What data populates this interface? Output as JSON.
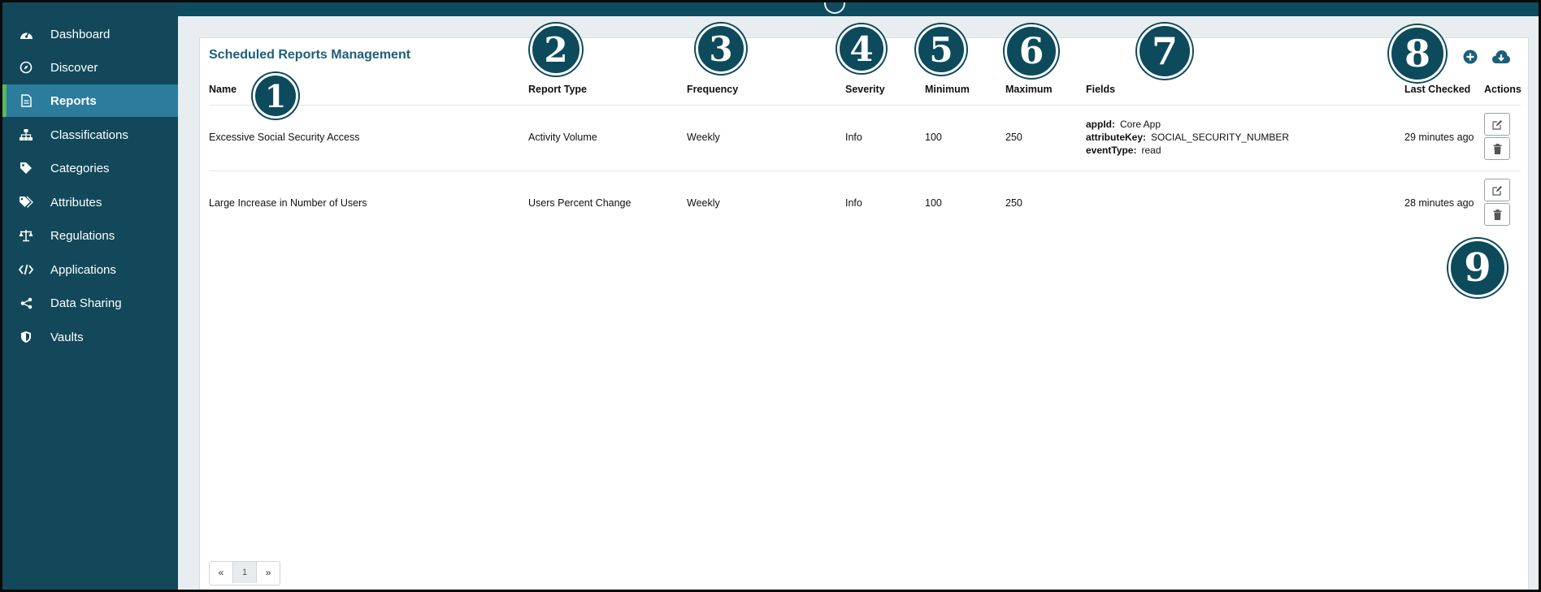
{
  "sidebar": {
    "items": [
      {
        "label": "Dashboard",
        "icon": "dashboard-icon"
      },
      {
        "label": "Discover",
        "icon": "compass-icon"
      },
      {
        "label": "Reports",
        "icon": "report-file-icon",
        "active": true
      },
      {
        "label": "Classifications",
        "icon": "sitemap-icon"
      },
      {
        "label": "Categories",
        "icon": "tag-icon"
      },
      {
        "label": "Attributes",
        "icon": "tags-icon"
      },
      {
        "label": "Regulations",
        "icon": "balance-scale-icon"
      },
      {
        "label": "Applications",
        "icon": "code-icon"
      },
      {
        "label": "Data Sharing",
        "icon": "share-icon"
      },
      {
        "label": "Vaults",
        "icon": "shield-icon"
      }
    ]
  },
  "panel": {
    "title": "Scheduled Reports Management",
    "columns": [
      "Name",
      "Report Type",
      "Frequency",
      "Severity",
      "Minimum",
      "Maximum",
      "Fields",
      "Last Checked",
      "Actions"
    ],
    "rows": [
      {
        "name": "Excessive Social Security Access",
        "report_type": "Activity Volume",
        "frequency": "Weekly",
        "severity": "Info",
        "minimum": "100",
        "maximum": "250",
        "fields": [
          {
            "key": "appId:",
            "value": "Core App"
          },
          {
            "key": "attributeKey:",
            "value": "SOCIAL_SECURITY_NUMBER"
          },
          {
            "key": "eventType:",
            "value": "read"
          }
        ],
        "last_checked": "29 minutes ago"
      },
      {
        "name": "Large Increase in Number of Users",
        "report_type": "Users Percent Change",
        "frequency": "Weekly",
        "severity": "Info",
        "minimum": "100",
        "maximum": "250",
        "fields": [],
        "last_checked": "28 minutes ago"
      }
    ],
    "toolbar": {
      "add_icon": "plus-circle-icon",
      "download_icon": "cloud-download-icon"
    },
    "pagination": {
      "prev": "«",
      "page": "1",
      "next": "»"
    }
  },
  "callouts": [
    "1",
    "2",
    "3",
    "4",
    "5",
    "6",
    "7",
    "8",
    "9"
  ],
  "colors": {
    "sidebar": "#12485a",
    "active": "#2c7c9e",
    "accent_bar": "#5cb85c",
    "title": "#1a5f79",
    "background": "#e8edf0"
  }
}
